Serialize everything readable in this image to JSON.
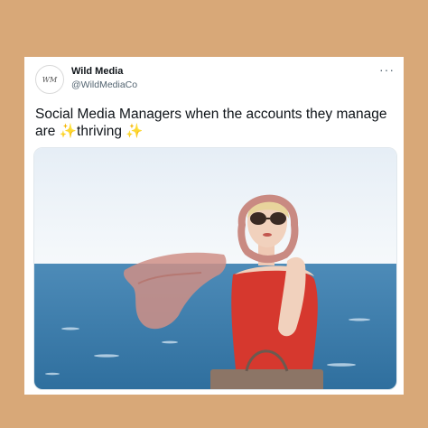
{
  "tweet": {
    "display_name": "Wild Media",
    "handle": "@WildMediaCo",
    "avatar_text": "WM",
    "text_before": "Social Media Managers when the accounts they manage are ",
    "emoji_left": "✨",
    "highlight": "thriving",
    "emoji_right": "✨",
    "more_label": "···"
  },
  "media": {
    "icon": "photo-woman-scarf-sea",
    "colors": {
      "sky": "#eef4fa",
      "sea": "#3f7fae",
      "dress": "#d6382e",
      "scarf": "#c98a82",
      "skin": "#f1d1bd",
      "hair": "#e8d49c"
    }
  },
  "colors": {
    "background": "#d8a878",
    "card": "#ffffff"
  }
}
